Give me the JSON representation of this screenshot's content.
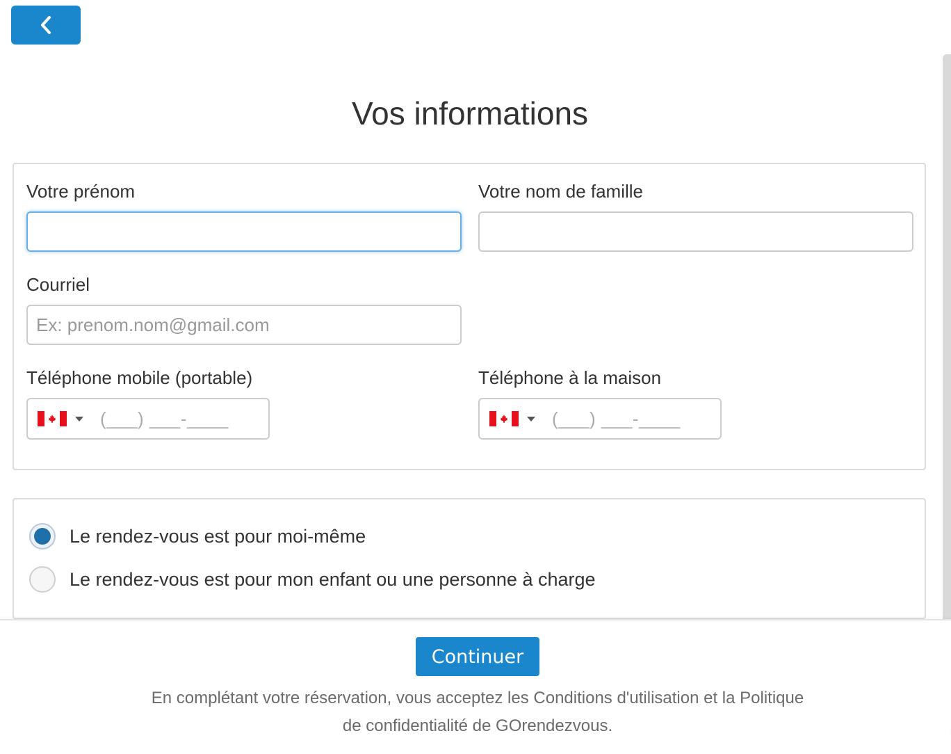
{
  "header": {
    "back_icon": "chevron-left-icon",
    "title": "Vos informations"
  },
  "form": {
    "first_name": {
      "label": "Votre prénom",
      "value": "",
      "placeholder": ""
    },
    "last_name": {
      "label": "Votre nom de famille",
      "value": "",
      "placeholder": ""
    },
    "email": {
      "label": "Courriel",
      "value": "",
      "placeholder": "Ex: prenom.nom@gmail.com"
    },
    "mobile_phone": {
      "label": "Téléphone mobile (portable)",
      "country": "CA",
      "mask": "(___) ___-____"
    },
    "home_phone": {
      "label": "Téléphone à la maison",
      "country": "CA",
      "mask": "(___) ___-____"
    }
  },
  "appointment_for": {
    "options": [
      {
        "label": "Le rendez-vous est pour moi-même",
        "selected": true
      },
      {
        "label": "Le rendez-vous est pour mon enfant ou une personne à charge",
        "selected": false
      }
    ]
  },
  "footer": {
    "continue_label": "Continuer",
    "terms_line1": "En complétant votre réservation, vous acceptez les Conditions d'utilisation et la Politique",
    "terms_line2": "de confidentialité de GOrendezvous."
  },
  "colors": {
    "accent": "#1a86cb",
    "focus_border": "#66afe9",
    "radio_selected": "#1f6fa8"
  }
}
